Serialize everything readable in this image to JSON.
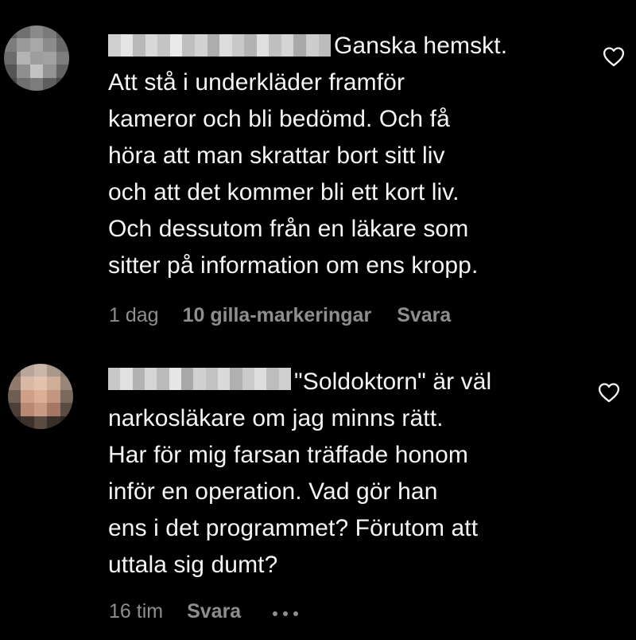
{
  "comments": [
    {
      "username": "",
      "first_line": "Ganska hemskt.",
      "lines": [
        "Att stå i underkläder framför",
        "kameror och bli bedömd. Och få",
        "höra att man skrattar bort sitt liv",
        "och att det kommer bli ett kort liv.",
        "Och dessutom från en läkare som",
        "sitter på information om ens kropp."
      ],
      "time": "1 dag",
      "likes": "10 gilla-markeringar",
      "reply": "Svara",
      "like_icon": "heart-outline-icon"
    },
    {
      "username": "",
      "first_line": "\"Soldoktorn\" är väl",
      "lines": [
        "narkosläkare om jag minns rätt.",
        "Har för mig farsan träffade honom",
        "inför en operation. Vad gör han",
        "ens i det programmet? Förutom att",
        "uttala sig dumt?"
      ],
      "time": "16 tim",
      "reply": "Svara",
      "more_icon": "more-options-icon",
      "like_icon": "heart-outline-icon"
    }
  ],
  "colors": {
    "background": "#000000",
    "text": "#f5f5f5",
    "meta": "#8e8e8e"
  }
}
